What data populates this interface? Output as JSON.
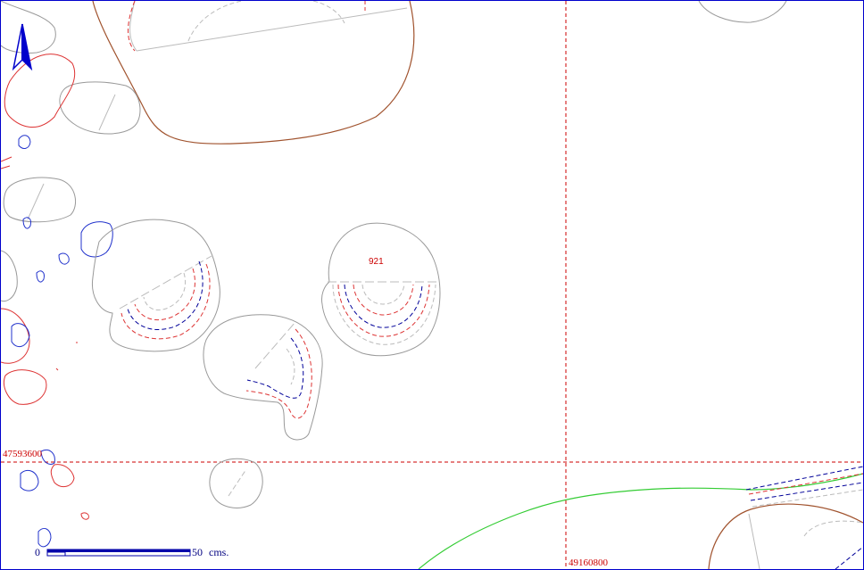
{
  "map": {
    "grid_labels": {
      "northing": "47593600",
      "easting": "49160800"
    },
    "feature_label": "921",
    "scale_bar": {
      "zero_label": "0",
      "end_label": "50",
      "unit_label": "cms."
    },
    "north_arrow_icon": "north-arrow-icon",
    "colors": {
      "grid": "#cc0000",
      "outline": "#999999",
      "brown_cut": "#a0522d",
      "contour_red": "#dd3333",
      "contour_blue": "#000099",
      "stone_blue": "#2233cc",
      "green_line": "#33cc33",
      "scale_bar": "#0000aa"
    }
  }
}
